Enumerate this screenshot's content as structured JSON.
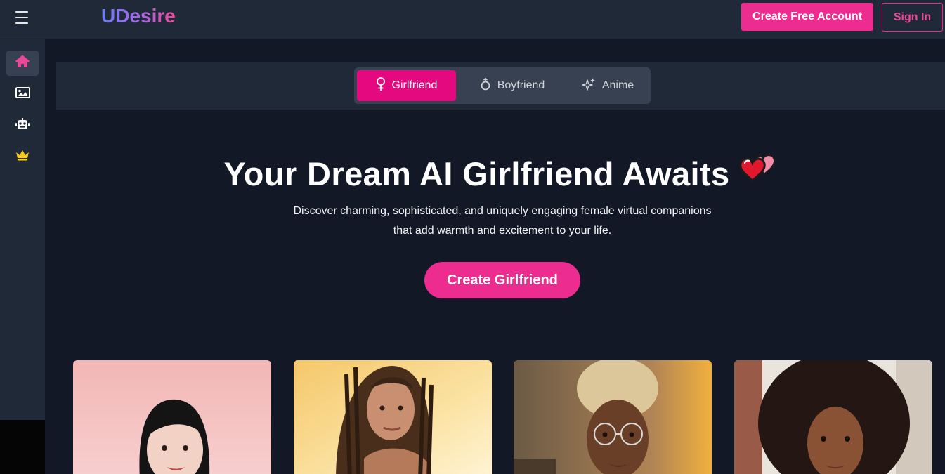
{
  "header": {
    "brand": "UDesire",
    "create_account_label": "Create Free Account",
    "sign_in_label": "Sign In"
  },
  "sidebar": {
    "items": [
      {
        "icon": "home-icon",
        "active": true
      },
      {
        "icon": "image-icon",
        "active": false
      },
      {
        "icon": "robot-icon",
        "active": false
      },
      {
        "icon": "crown-icon",
        "active": false
      }
    ]
  },
  "tabs": [
    {
      "label": "Girlfriend",
      "icon": "female-icon",
      "active": true
    },
    {
      "label": "Boyfriend",
      "icon": "male-icon",
      "active": false
    },
    {
      "label": "Anime",
      "icon": "sparkles-icon",
      "active": false
    }
  ],
  "hero": {
    "title": "Your Dream AI Girlfriend Awaits",
    "subtitle_line1": "Discover charming, sophisticated, and uniquely engaging female virtual companions",
    "subtitle_line2": "that add warmth and excitement to your life.",
    "cta_label": "Create Girlfriend"
  },
  "colors": {
    "accent": "#ec2d8f",
    "tab_active": "#e5097f",
    "background": "#121826",
    "panel": "#1f2937",
    "crown": "#facc15"
  }
}
